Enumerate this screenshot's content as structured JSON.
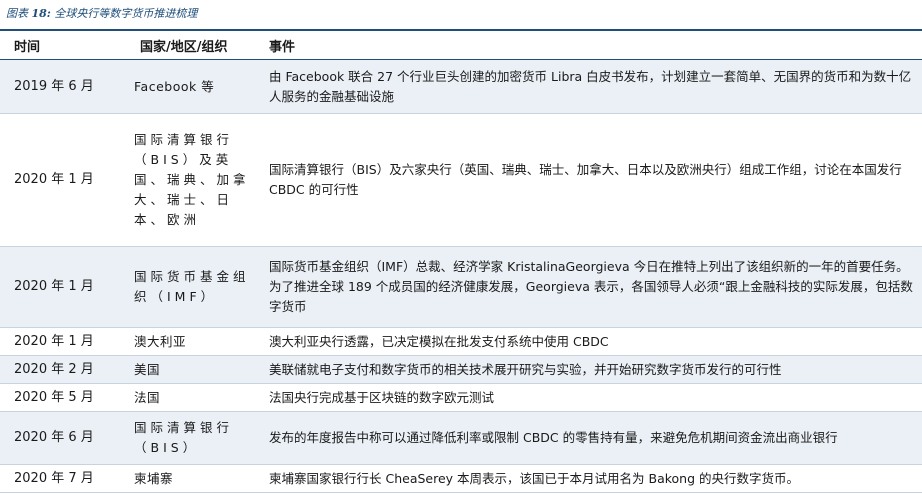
{
  "caption": {
    "prefix": "图表",
    "number": "18:",
    "title": "全球央行等数字货币推进梳理"
  },
  "colors": {
    "accent": "#1f4e79",
    "row_shade": "#eaf0f6"
  },
  "table": {
    "headers": [
      "时间",
      "国家/地区/组织",
      "事件"
    ],
    "rows": [
      {
        "date": "2019 年 6 月",
        "org": "Facebook 等",
        "event": "由 Facebook 联合 27 个行业巨头创建的加密货币 Libra 白皮书发布，计划建立一套简单、无国界的货币和为数十亿人服务的金融基础设施"
      },
      {
        "date": "2020 年 1 月",
        "org": "国际清算银行（BIS）及英国、瑞典、加拿大、瑞士、日本、欧洲",
        "event": "国际清算银行（BIS）及六家央行（英国、瑞典、瑞士、加拿大、日本以及欧洲央行）组成工作组，讨论在本国发行 CBDC 的可行性"
      },
      {
        "date": "2020 年 1 月",
        "org": "国际货币基金组织（IMF）",
        "event": "国际货币基金组织（IMF）总裁、经济学家 KristalinaGeorgieva 今日在推特上列出了该组织新的一年的首要任务。为了推进全球 189 个成员国的经济健康发展，Georgieva 表示，各国领导人必须“跟上金融科技的实际发展，包括数字货币"
      },
      {
        "date": "2020 年 1 月",
        "org": "澳大利亚",
        "event": "澳大利亚央行透露，已决定模拟在批发支付系统中使用 CBDC"
      },
      {
        "date": "2020 年 2 月",
        "org": "美国",
        "event": "美联储就电子支付和数字货币的相关技术展开研究与实验，并开始研究数字货币发行的可行性"
      },
      {
        "date": "2020 年 5 月",
        "org": "法国",
        "event": "法国央行完成基于区块链的数字欧元测试"
      },
      {
        "date": "2020 年 6 月",
        "org": "国际清算银行（BIS）",
        "event": "发布的年度报告中称可以通过降低利率或限制 CBDC 的零售持有量，来避免危机期间资金流出商业银行"
      },
      {
        "date": "2020 年 7 月",
        "org": "柬埔寨",
        "event": "柬埔寨国家银行行长 CheaSerey 本周表示，该国已于本月试用名为 Bakong 的央行数字货币。"
      }
    ]
  }
}
